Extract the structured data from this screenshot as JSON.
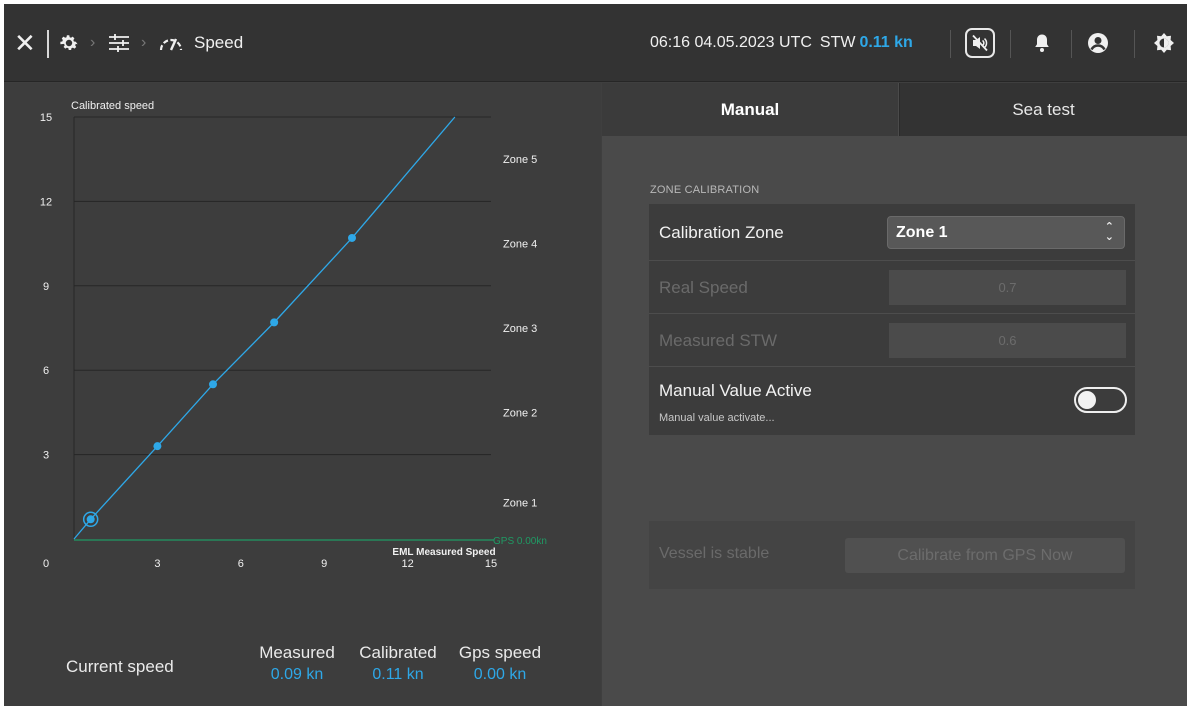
{
  "topbar": {
    "breadcrumb_current": "Speed",
    "datetime": "06:16 04.05.2023 UTC",
    "stw_label": "STW",
    "stw_value": "0.11 kn",
    "icons": [
      "close-icon",
      "gear-icon",
      "sliders-icon",
      "gauge-icon",
      "mute-icon",
      "bell-icon",
      "user-icon",
      "brightness-icon"
    ]
  },
  "chart_data": {
    "type": "line",
    "ylabel": "Calibrated speed",
    "xlabel": "EML Measured Speed",
    "xlim": [
      0,
      15
    ],
    "ylim": [
      0,
      15
    ],
    "x_ticks": [
      "0",
      "3",
      "6",
      "9",
      "12",
      "15"
    ],
    "y_ticks": [
      "15",
      "12",
      "9",
      "6",
      "3"
    ],
    "series": [
      {
        "x": [
          0,
          0.6,
          3.0,
          5.0,
          7.2,
          10.0,
          13.7
        ],
        "y": [
          0,
          0.7,
          3.3,
          5.5,
          7.7,
          10.7,
          15.0
        ]
      }
    ],
    "calibration_points": [
      {
        "x": 0.6,
        "y": 0.7,
        "selected": true
      },
      {
        "x": 3.0,
        "y": 3.3
      },
      {
        "x": 5.0,
        "y": 5.5
      },
      {
        "x": 7.2,
        "y": 7.7
      },
      {
        "x": 10.0,
        "y": 10.7
      }
    ],
    "zones": [
      {
        "label": "Zone 5",
        "y": 13.5
      },
      {
        "label": "Zone 4",
        "y": 10.5
      },
      {
        "label": "Zone 3",
        "y": 7.5
      },
      {
        "label": "Zone 2",
        "y": 4.5
      },
      {
        "label": "Zone 1",
        "y": 1.3
      }
    ],
    "gps_line": {
      "label": "GPS 0.00kn",
      "y": 0.0
    },
    "colors": {
      "line": "#2ea8e8",
      "point": "#2ea8e8",
      "gps": "#1f9a64",
      "grid": "#262626",
      "axis_text": "#f0f0f0",
      "zone_text": "#f0f0f0"
    },
    "grid": true
  },
  "speed_summary": {
    "current_speed_label": "Current speed",
    "measured_label": "Measured",
    "measured_value": "0.09 kn",
    "calibrated_label": "Calibrated",
    "calibrated_value": "0.11 kn",
    "gps_label": "Gps speed",
    "gps_value": "0.00 kn"
  },
  "tabs": {
    "manual": "Manual",
    "sea_test": "Sea test"
  },
  "zone_calibration": {
    "section_title": "ZONE CALIBRATION",
    "calibration_zone_label": "Calibration Zone",
    "calibration_zone_value": "Zone 1",
    "real_speed_label": "Real Speed",
    "real_speed_value": "0.7",
    "measured_stw_label": "Measured STW",
    "measured_stw_value": "0.6",
    "manual_value_active_label": "Manual Value Active",
    "manual_value_active_sub": "Manual value activate...",
    "manual_value_active_on": false
  },
  "gps_calibration": {
    "status_label": "Vessel is stable",
    "button_label": "Calibrate from GPS Now"
  },
  "accent_color": "#2ea8e8"
}
